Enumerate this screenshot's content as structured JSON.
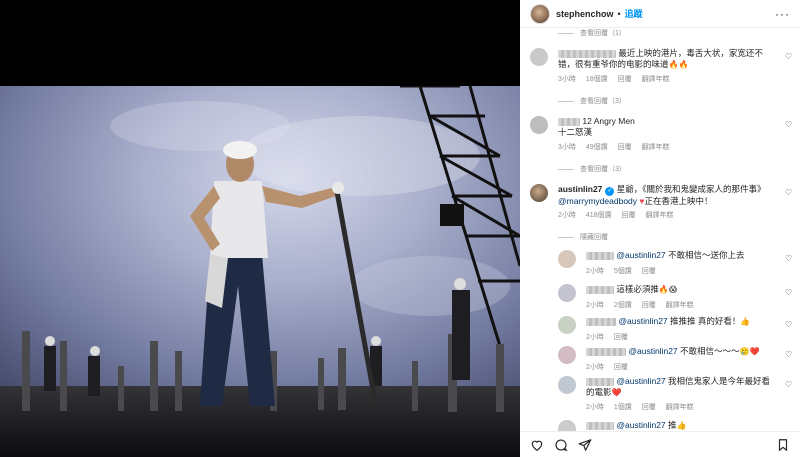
{
  "header": {
    "username": "stephenchow",
    "separator": "•",
    "follow_label": "追蹤",
    "more_label": "···"
  },
  "replies_top": "查看回覆（1）",
  "comments": [
    {
      "id": "c1",
      "text": "最近上映的港片，毒舌大状，家宽还不错，很有重爷你的电影的味道",
      "emoji": "🔥🔥",
      "time": "3小時",
      "likes": "18個讚",
      "reply": "回覆",
      "translate": "翻譯年糕",
      "replies_label": "查看回覆（3）"
    },
    {
      "id": "c2",
      "text": "12 Angry Men",
      "text2": "十二怒漢",
      "time": "3小時",
      "likes": "49個讚",
      "reply": "回覆",
      "translate": "翻譯年糕",
      "replies_label": "查看回覆（3）"
    },
    {
      "id": "c3",
      "username": "austinlin27",
      "text": "星爺，《關於我和鬼變成家人的那件事》",
      "mention": "@marrymydeadbody",
      "text2": "正在香港上映中！",
      "time": "2小時",
      "likes": "418個讚",
      "reply": "回覆",
      "translate": "翻譯年糕",
      "replies_label": "隱藏回覆"
    }
  ],
  "sub_replies": [
    {
      "id": "r1",
      "mention": "@austinlin27",
      "text": "不敢相信～送你上去",
      "time": "2小時",
      "likes": "5個讚",
      "reply": "回覆"
    },
    {
      "id": "r2",
      "text": "這樣必須推",
      "emoji": "🔥😱",
      "time": "2小時",
      "likes": "2個讚",
      "reply": "回覆",
      "translate": "翻譯年糕"
    },
    {
      "id": "r3",
      "mention": "@austinlin27",
      "text": "推推推 真的好看！",
      "emoji": "👍",
      "time": "2小時",
      "likes": "",
      "reply": "回覆"
    },
    {
      "id": "r4",
      "mention": "@austinlin27",
      "text": "不敢相信～～～",
      "emoji": "🥲❤️",
      "time": "2小時",
      "likes": "",
      "reply": "回覆"
    },
    {
      "id": "r5",
      "mention": "@austinlin27",
      "text": "我相信鬼家人是今年最好看的電影",
      "emoji": "❤️",
      "time": "2小時",
      "likes": "1個讚",
      "reply": "回覆",
      "translate": "翻譯年糕"
    },
    {
      "id": "r6",
      "mention": "@austinlin27",
      "text": "推",
      "emoji": "👍",
      "time": "",
      "likes": "",
      "reply": ""
    }
  ],
  "icons": {
    "like": "heart-icon",
    "comment": "comment-icon",
    "share": "share-icon",
    "save": "bookmark-icon"
  },
  "colors": {
    "accent": "#0095f6",
    "link": "#00376b",
    "muted": "#8e8e8e",
    "heart_red": "#ed4956"
  }
}
